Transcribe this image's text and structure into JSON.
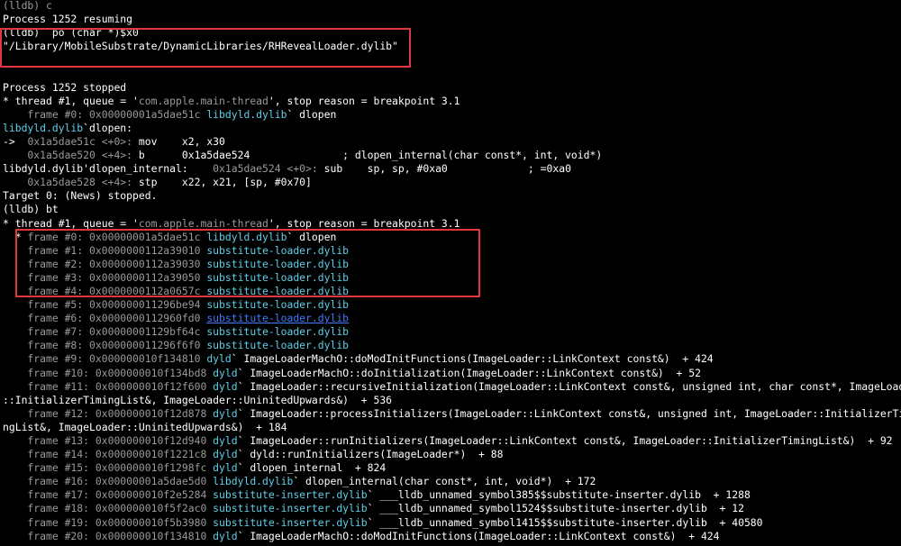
{
  "accent_colors": {
    "cyan": "#5fd0e8",
    "gray": "#9a9a9a",
    "highlight_box": "#e0383e",
    "link": "#3f7bff"
  },
  "lines": [
    [
      {
        "t": "(lldb) c",
        "c": "g"
      }
    ],
    [
      {
        "t": "Process 1252 resuming"
      }
    ],
    [
      {
        "t": "(lldb)  po (char *)$x0"
      }
    ],
    [
      {
        "t": "\"/Library/MobileSubstrate/DynamicLibraries/RHRevealLoader.dylib\""
      }
    ],
    [],
    [],
    [
      {
        "t": "Process 1252 stopped"
      }
    ],
    [
      {
        "t": "* thread #1, queue = '"
      },
      {
        "t": "com.apple.main-thread",
        "c": "g"
      },
      {
        "t": "', stop reason = breakpoint 3.1"
      }
    ],
    [
      {
        "t": "    frame #0: 0x00000001a5dae51c ",
        "c": "g"
      },
      {
        "t": "libdyld.dylib",
        "c": "c"
      },
      {
        "t": "` dlopen"
      }
    ],
    [
      {
        "t": "libdyld.dylib",
        "c": "c"
      },
      {
        "t": "`dlopen:"
      }
    ],
    [
      {
        "t": "->  "
      },
      {
        "t": "0x1a5dae51c <+0>: ",
        "c": "g"
      },
      {
        "t": "mov    x2, x30"
      }
    ],
    [
      {
        "t": "    0x1a5dae520 <+4>: ",
        "c": "g"
      },
      {
        "t": "b      0x1a5dae524               ; dlopen_internal(char const*, int, void*)"
      }
    ],
    [
      {
        "t": "libdyld.dylib'dlopen_internal:    "
      },
      {
        "t": "0x1a5dae524 <+0>: ",
        "c": "g"
      },
      {
        "t": "sub    sp, sp, #0xa0             ; =0xa0"
      }
    ],
    [
      {
        "t": "    0x1a5dae528 <+4>: ",
        "c": "g"
      },
      {
        "t": "stp    x22, x21, [sp, #0x70]"
      }
    ],
    [
      {
        "t": "Target 0: (News) stopped."
      }
    ],
    [
      {
        "t": "(lldb) bt"
      }
    ],
    [
      {
        "t": "* thread #1, queue = '"
      },
      {
        "t": "com.apple.main-thread",
        "c": "g"
      },
      {
        "t": "', stop reason = breakpoint 3.1"
      }
    ],
    [
      {
        "t": "  * "
      },
      {
        "t": "frame #0: 0x00000001a5dae51c ",
        "c": "g"
      },
      {
        "t": "libdyld.dylib",
        "c": "c"
      },
      {
        "t": "` dlopen"
      }
    ],
    [
      {
        "t": "    frame #1: 0x0000000112a39010 ",
        "c": "g"
      },
      {
        "t": "substitute-loader.dylib",
        "c": "c"
      }
    ],
    [
      {
        "t": "    frame #2: 0x0000000112a39030 ",
        "c": "g"
      },
      {
        "t": "substitute-loader.dylib",
        "c": "c"
      }
    ],
    [
      {
        "t": "    frame #3: 0x0000000112a39050 ",
        "c": "g"
      },
      {
        "t": "substitute-loader.dylib",
        "c": "c"
      }
    ],
    [
      {
        "t": "    frame #4: 0x0000000112a0657c ",
        "c": "g"
      },
      {
        "t": "substitute-loader.dylib",
        "c": "c"
      }
    ],
    [
      {
        "t": "    frame #5: 0x000000011296be94 ",
        "c": "g"
      },
      {
        "t": "substitute-loader.dylib",
        "c": "c"
      }
    ],
    [
      {
        "t": "    frame #6: 0x0000000112960fd0 ",
        "c": "g"
      },
      {
        "t": "substitute-loader.dylib",
        "c": "lk"
      }
    ],
    [
      {
        "t": "    frame #7: 0x00000001129bf64c ",
        "c": "g"
      },
      {
        "t": "substitute-loader.dylib",
        "c": "c"
      }
    ],
    [
      {
        "t": "    frame #8: 0x000000011296f6f0 ",
        "c": "g"
      },
      {
        "t": "substitute-loader.dylib",
        "c": "c"
      }
    ],
    [
      {
        "t": "    frame #9: 0x000000010f134810 ",
        "c": "g"
      },
      {
        "t": "dyld",
        "c": "c"
      },
      {
        "t": "` ImageLoaderMachO::doModInitFunctions(ImageLoader::LinkContext const&)  + 424"
      }
    ],
    [
      {
        "t": "    frame #10: 0x000000010f134bd8 ",
        "c": "g"
      },
      {
        "t": "dyld",
        "c": "c"
      },
      {
        "t": "` ImageLoaderMachO::doInitialization(ImageLoader::LinkContext const&)  + 52"
      }
    ],
    [
      {
        "t": "    frame #11: 0x000000010f12f600 ",
        "c": "g"
      },
      {
        "t": "dyld",
        "c": "c"
      },
      {
        "t": "` ImageLoader::recursiveInitialization(ImageLoader::LinkContext const&, unsigned int, char const*, ImageLoader"
      }
    ],
    [
      {
        "t": "::InitializerTimingList&, ImageLoader::UninitedUpwards&)  + 536"
      }
    ],
    [
      {
        "t": "    frame #12: 0x000000010f12d878 ",
        "c": "g"
      },
      {
        "t": "dyld",
        "c": "c"
      },
      {
        "t": "` ImageLoader::processInitializers(ImageLoader::LinkContext const&, unsigned int, ImageLoader::InitializerTimi"
      }
    ],
    [
      {
        "t": "ngList&, ImageLoader::UninitedUpwards&)  + 184"
      }
    ],
    [
      {
        "t": "    frame #13: 0x000000010f12d940 ",
        "c": "g"
      },
      {
        "t": "dyld",
        "c": "c"
      },
      {
        "t": "` ImageLoader::runInitializers(ImageLoader::LinkContext const&, ImageLoader::InitializerTimingList&)  + 92"
      }
    ],
    [
      {
        "t": "    frame #14: 0x000000010f1221c8 ",
        "c": "g"
      },
      {
        "t": "dyld",
        "c": "c"
      },
      {
        "t": "` dyld::runInitializers(ImageLoader*)  + 88"
      }
    ],
    [
      {
        "t": "    frame #15: 0x000000010f1298fc ",
        "c": "g"
      },
      {
        "t": "dyld",
        "c": "c"
      },
      {
        "t": "` dlopen_internal  + 824"
      }
    ],
    [
      {
        "t": "    frame #16: 0x00000001a5dae5d0 ",
        "c": "g"
      },
      {
        "t": "libdyld.dylib",
        "c": "c"
      },
      {
        "t": "` dlopen_internal(char const*, int, void*)  + 172"
      }
    ],
    [
      {
        "t": "    frame #17: 0x000000010f2e5284 ",
        "c": "g"
      },
      {
        "t": "substitute-inserter.dylib",
        "c": "c"
      },
      {
        "t": "` ___lldb_unnamed_symbol385$$substitute-inserter.dylib  + 1288"
      }
    ],
    [
      {
        "t": "    frame #18: 0x000000010f5f2ac0 ",
        "c": "g"
      },
      {
        "t": "substitute-inserter.dylib",
        "c": "c"
      },
      {
        "t": "` ___lldb_unnamed_symbol1524$$substitute-inserter.dylib  + 12"
      }
    ],
    [
      {
        "t": "    frame #19: 0x000000010f5b3980 ",
        "c": "g"
      },
      {
        "t": "substitute-inserter.dylib",
        "c": "c"
      },
      {
        "t": "` ___lldb_unnamed_symbol1415$$substitute-inserter.dylib  + 40580"
      }
    ],
    [
      {
        "t": "    frame #20: 0x000000010f134810 ",
        "c": "g"
      },
      {
        "t": "dyld",
        "c": "c"
      },
      {
        "t": "` ImageLoaderMachO::doModInitFunctions(ImageLoader::LinkContext const&)  + 424"
      }
    ]
  ]
}
